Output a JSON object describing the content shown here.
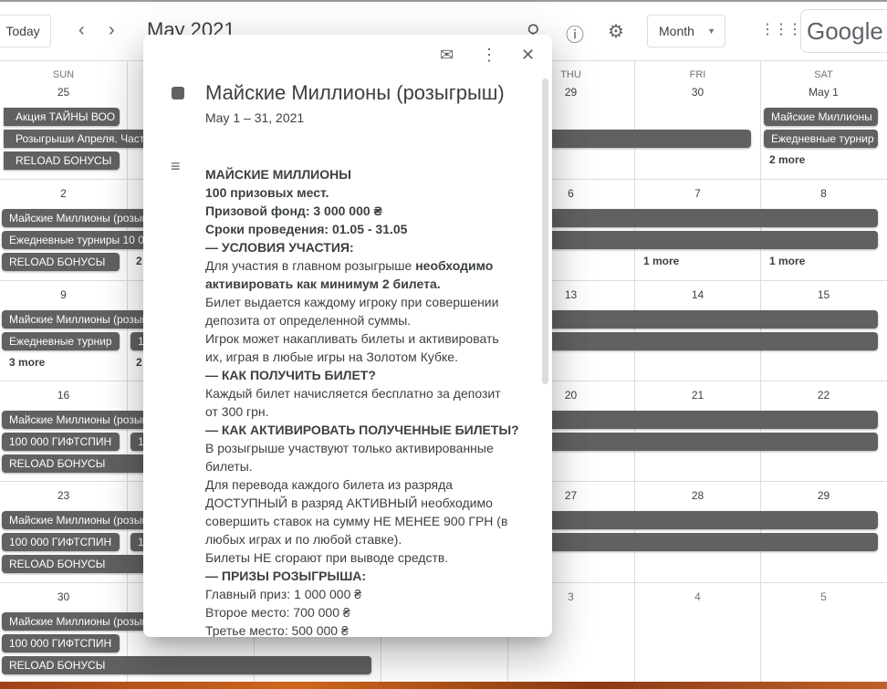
{
  "topbar": {
    "today": "Today",
    "prev_icon": "chevron-left-icon",
    "next_icon": "chevron-right-icon",
    "title": "May 2021",
    "search_icon": "search-icon",
    "help_icon": "help-icon",
    "settings_icon": "gear-icon",
    "view": "Month",
    "apps_icon": "apps-grid-icon",
    "logo": "Google"
  },
  "calendar": {
    "weekdays": [
      "SUN",
      "",
      "",
      "",
      "THU",
      "FRI",
      "SAT"
    ],
    "event_color": "#616161",
    "weeks": [
      {
        "days": [
          "25",
          "",
          "",
          "",
          "29",
          "30",
          "May 1"
        ],
        "events": [
          {
            "label": "Акция ТАЙНЫ ВОО",
            "from": "Sun",
            "to": "Sun",
            "lane": 0,
            "continued": true,
            "truncated": true
          },
          {
            "label": "Розыгрыши Апреля. Частка",
            "from": "Sun",
            "to": "Fri",
            "lane": 1,
            "continued": true
          },
          {
            "label": "RELOAD БОНУСЫ",
            "from": "Sun",
            "to": "Sun",
            "lane": 2,
            "continued": true,
            "truncated": true
          },
          {
            "label": "Майские Миллионы",
            "from": "Sat",
            "to": "Sat",
            "lane": 0
          },
          {
            "label": "Ежедневные турнир",
            "from": "Sat",
            "to": "Sat",
            "lane": 1
          }
        ],
        "more": [
          {
            "day": "Sat",
            "label": "2 more"
          }
        ]
      },
      {
        "days": [
          "2",
          "",
          "",
          "",
          "6",
          "7",
          "8"
        ],
        "events": [
          {
            "label": "Майские Миллионы (розыгрыш)",
            "from": "Sun",
            "to": "Sat",
            "lane": 0
          },
          {
            "label": "Ежедневные турниры 10 000",
            "from": "Sun",
            "to": "Sat",
            "lane": 1
          },
          {
            "label": "RELOAD БОНУСЫ",
            "from": "Sun",
            "to": "Sun",
            "lane": 2,
            "truncated": true
          }
        ],
        "more": [
          {
            "day": "Mon",
            "label": "2 more"
          },
          {
            "day": "Fri",
            "label": "1 more"
          },
          {
            "day": "Sat",
            "label": "1 more"
          }
        ]
      },
      {
        "days": [
          "9",
          "",
          "",
          "",
          "13",
          "14",
          "15"
        ],
        "events": [
          {
            "label": "Майские Миллионы (розыгрыш)",
            "from": "Sun",
            "to": "Sat",
            "lane": 0
          },
          {
            "label": "Ежедневные турнир",
            "from": "Sun",
            "to": "Sun",
            "lane": 1,
            "truncated": true
          },
          {
            "label": "10",
            "from": "Mon",
            "to": "Sat",
            "lane": 1
          }
        ],
        "more": [
          {
            "day": "Sun",
            "label": "3 more"
          },
          {
            "day": "Mon",
            "label": "2 more"
          }
        ]
      },
      {
        "days": [
          "16",
          "",
          "",
          "",
          "20",
          "21",
          "22"
        ],
        "events": [
          {
            "label": "Майские Миллионы (розыгрыш)",
            "from": "Sun",
            "to": "Sat",
            "lane": 0
          },
          {
            "label": "100 000 ГИФТСПИН",
            "from": "Sun",
            "to": "Sun",
            "lane": 1,
            "truncated": true
          },
          {
            "label": "10",
            "from": "Mon",
            "to": "Sat",
            "lane": 1
          },
          {
            "label": "RELOAD БОНУСЫ",
            "from": "Sun",
            "to": "Tue",
            "lane": 2
          }
        ],
        "more": []
      },
      {
        "days": [
          "23",
          "",
          "",
          "",
          "27",
          "28",
          "29"
        ],
        "events": [
          {
            "label": "Майские Миллионы (розыгрыш)",
            "from": "Sun",
            "to": "Sat",
            "lane": 0
          },
          {
            "label": "100 000 ГИФТСПИН",
            "from": "Sun",
            "to": "Sun",
            "lane": 1,
            "truncated": true
          },
          {
            "label": "10",
            "from": "Mon",
            "to": "Sat",
            "lane": 1
          },
          {
            "label": "RELOAD БОНУСЫ",
            "from": "Sun",
            "to": "Tue",
            "lane": 2
          }
        ],
        "more": []
      },
      {
        "days": [
          "30",
          "",
          "",
          "",
          "3",
          "4",
          "5"
        ],
        "grey_from": "Tue",
        "events": [
          {
            "label": "Майские Миллионы (розыгрыш)",
            "from": "Sun",
            "to": "Mon",
            "lane": 0
          },
          {
            "label": "100 000 ГИФТСПИН",
            "from": "Sun",
            "to": "Sun",
            "lane": 1,
            "truncated": true
          },
          {
            "label": "RELOAD БОНУСЫ",
            "from": "Sun",
            "to": "Tue",
            "lane": 2
          }
        ],
        "more": []
      }
    ]
  },
  "popup": {
    "email_icon": "email-icon",
    "more_icon": "more-vert-icon",
    "close_icon": "close-icon",
    "title": "Майские Миллионы (розыгрыш)",
    "date": "May 1 – 31, 2021",
    "description_icon": "description-icon",
    "lines": [
      [
        {
          "t": "МАЙСКИЕ МИЛЛИОНЫ",
          "b": true
        }
      ],
      [
        {
          "t": "100 призовых мест.",
          "b": true
        }
      ],
      [
        {
          "t": "Призовой фонд: 3 000 000 ₴",
          "b": true
        }
      ],
      [
        {
          "t": "Сроки проведения: 01.05 - 31.05",
          "b": true
        }
      ],
      [
        {
          "t": "— УСЛОВИЯ УЧАСТИЯ:",
          "b": true
        }
      ],
      [
        {
          "t": "Для участия в главном розыгрыше ",
          "b": false
        },
        {
          "t": "необходимо",
          "b": true
        }
      ],
      [
        {
          "t": "активировать как минимум 2 билета.",
          "b": true
        }
      ],
      [
        {
          "t": "Билет выдается каждому игроку при совершении",
          "b": false
        }
      ],
      [
        {
          "t": "депозита от определенной суммы.",
          "b": false
        }
      ],
      [
        {
          "t": "Игрок может накапливать билеты и активировать",
          "b": false
        }
      ],
      [
        {
          "t": "их, играя в любые игры на Золотом Кубке.",
          "b": false
        }
      ],
      [
        {
          "t": "— КАК ПОЛУЧИТЬ БИЛЕТ?",
          "b": true
        }
      ],
      [
        {
          "t": "Каждый билет начисляется бесплатно за депозит",
          "b": false
        }
      ],
      [
        {
          "t": "от 300 грн.",
          "b": false
        }
      ],
      [
        {
          "t": "— КАК АКТИВИРОВАТЬ ПОЛУЧЕННЫЕ БИЛЕТЫ?",
          "b": true
        }
      ],
      [
        {
          "t": "В розыгрыше участвуют только активированные",
          "b": false
        }
      ],
      [
        {
          "t": "билеты.",
          "b": false
        }
      ],
      [
        {
          "t": "Для перевода каждого билета из разряда",
          "b": false
        }
      ],
      [
        {
          "t": "ДОСТУПНЫЙ в разряд АКТИВНЫЙ необходимо",
          "b": false
        }
      ],
      [
        {
          "t": "совершить ставок на сумму НЕ МЕНЕЕ 900 ГРН (в",
          "b": false
        }
      ],
      [
        {
          "t": "любых играх и по любой ставке).",
          "b": false
        }
      ],
      [
        {
          "t": "Билеты НЕ сгорают при выводе средств.",
          "b": false
        }
      ],
      [
        {
          "t": "— ПРИЗЫ РОЗЫГРЫША:",
          "b": true
        }
      ],
      [
        {
          "t": "Главный приз: 1 000 000 ₴",
          "b": false
        }
      ],
      [
        {
          "t": "Второе место: 700 000 ₴",
          "b": false
        }
      ],
      [
        {
          "t": "Третье место: 500 000 ₴",
          "b": false
        }
      ]
    ]
  }
}
